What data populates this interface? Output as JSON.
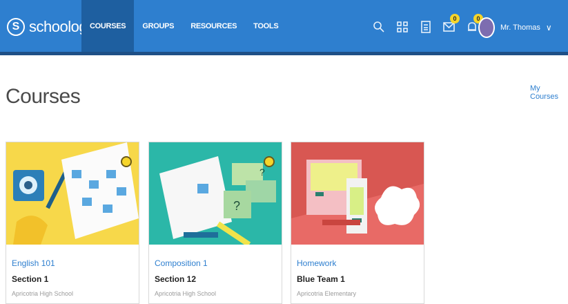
{
  "brand": {
    "mark": "S",
    "name": "schoology"
  },
  "nav": [
    {
      "label": "COURSES",
      "active": true
    },
    {
      "label": "GROUPS",
      "active": false
    },
    {
      "label": "RESOURCES",
      "active": false
    },
    {
      "label": "TOOLS",
      "active": false
    }
  ],
  "toolbar": {
    "icons": [
      "search-icon",
      "apps-grid-icon",
      "calendar-icon",
      "messages-icon",
      "notifications-icon"
    ],
    "messages_badge": "0",
    "notifications_badge": "0",
    "user_name": "Mr. Thomas",
    "caret": "∨"
  },
  "page": {
    "title": "Courses",
    "my_courses_link": "My Courses"
  },
  "courses": [
    {
      "title": "English 101",
      "section": "Section 1",
      "school": "Apricotria High School"
    },
    {
      "title": "Composition 1",
      "section": "Section 12",
      "school": "Apricotria High School"
    },
    {
      "title": "Homework",
      "section": "Blue Team 1",
      "school": "Apricotria Elementary"
    }
  ],
  "colors": {
    "nav_bg": "#2e7fcf",
    "nav_active": "#1e5fa0",
    "badge": "#f6d52a",
    "link": "#2e7fcf",
    "card1_bg": "#f7d84a",
    "card2_bg": "#2bb7a8",
    "card3_bg": "#e86a66"
  }
}
